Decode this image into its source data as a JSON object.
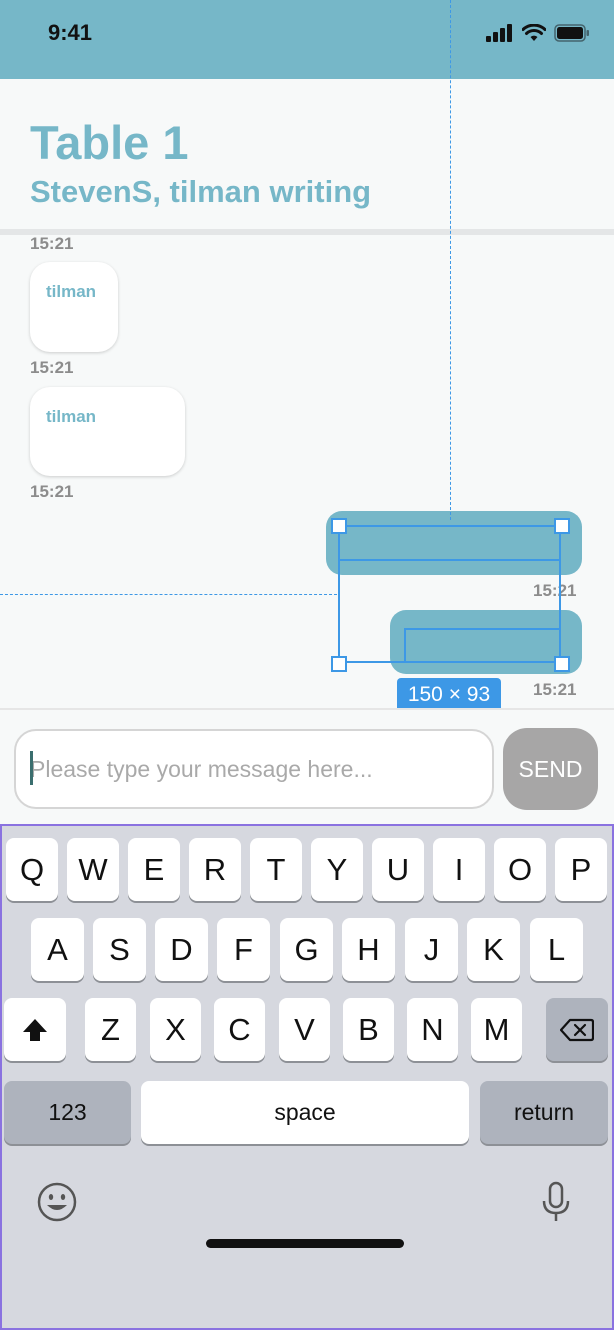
{
  "status": {
    "time": "9:41"
  },
  "header": {
    "title": "Table 1",
    "subtitle": "StevenS, tilman writing"
  },
  "chat": {
    "top_timestamp": "15:21",
    "incoming": [
      {
        "sender": "tilman",
        "timestamp": "15:21"
      },
      {
        "sender": "tilman",
        "timestamp": "15:21"
      }
    ],
    "outgoing": [
      {
        "timestamp": "15:21"
      },
      {
        "timestamp": "15:21"
      }
    ]
  },
  "selection": {
    "size_label": "150 × 93"
  },
  "composer": {
    "placeholder": "Please type your message here...",
    "send_label": "SEND"
  },
  "keyboard": {
    "row1": [
      "Q",
      "W",
      "E",
      "R",
      "T",
      "Y",
      "U",
      "I",
      "O",
      "P"
    ],
    "row2": [
      "A",
      "S",
      "D",
      "F",
      "G",
      "H",
      "J",
      "K",
      "L"
    ],
    "row3": [
      "Z",
      "X",
      "C",
      "V",
      "B",
      "N",
      "M"
    ],
    "numbers_label": "123",
    "space_label": "space",
    "return_label": "return",
    "icons": {
      "shift": "shift-icon",
      "delete": "delete-icon",
      "emoji": "emoji-icon",
      "mic": "microphone-icon"
    }
  },
  "colors": {
    "accent": "#76b7c8",
    "selection": "#3d98e6",
    "keyboard_border": "#8a72e0"
  }
}
